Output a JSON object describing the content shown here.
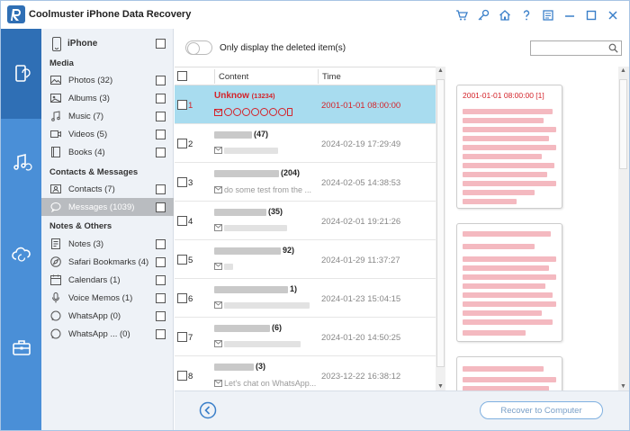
{
  "app": {
    "title": "Coolmuster iPhone Data Recovery"
  },
  "titlebar_icons": [
    "cart-icon",
    "key-icon",
    "home-icon",
    "help-icon",
    "feedback-icon",
    "minimize-icon",
    "maximize-icon",
    "close-icon"
  ],
  "rail": [
    "device-recovery-icon",
    "itunes-recovery-icon",
    "icloud-recovery-icon",
    "toolkit-icon"
  ],
  "sidebar": {
    "device": "iPhone",
    "sections": [
      {
        "title": "Media",
        "items": [
          {
            "label": "Photos  (32)",
            "icon": "photo-icon"
          },
          {
            "label": "Albums  (3)",
            "icon": "album-icon"
          },
          {
            "label": "Music  (7)",
            "icon": "music-icon"
          },
          {
            "label": "Videos  (5)",
            "icon": "video-icon"
          },
          {
            "label": "Books  (4)",
            "icon": "book-icon"
          }
        ]
      },
      {
        "title": "Contacts & Messages",
        "items": [
          {
            "label": "Contacts  (7)",
            "icon": "contact-icon"
          },
          {
            "label": "Messages  (1039)",
            "icon": "message-icon"
          }
        ]
      },
      {
        "title": "Notes & Others",
        "items": [
          {
            "label": "Notes  (3)",
            "icon": "note-icon"
          },
          {
            "label": "Safari Bookmarks  (4)",
            "icon": "safari-icon"
          },
          {
            "label": "Calendars  (1)",
            "icon": "calendar-icon"
          },
          {
            "label": "Voice Memos  (1)",
            "icon": "mic-icon"
          },
          {
            "label": "WhatsApp  (0)",
            "icon": "whatsapp-icon"
          },
          {
            "label": "WhatsApp ...  (0)",
            "icon": "whatsapp-icon"
          }
        ]
      }
    ]
  },
  "toolbar": {
    "toggle_label": "Only display the deleted item(s)",
    "search_placeholder": ""
  },
  "table": {
    "headers": {
      "content": "Content",
      "time": "Time"
    },
    "rows": [
      {
        "num": "1",
        "name": "Unknow",
        "count": "(13234)",
        "preview": "",
        "time": "2001-01-01 08:00:00"
      },
      {
        "num": "2",
        "name": "",
        "count": "(47)",
        "preview": "",
        "time": "2024-02-19 17:29:49"
      },
      {
        "num": "3",
        "name": "",
        "count": "(204)",
        "preview": "do some test from the ...",
        "time": "2024-02-05 14:38:53"
      },
      {
        "num": "4",
        "name": "",
        "count": "(35)",
        "preview": "",
        "time": "2024-02-01 19:21:26"
      },
      {
        "num": "5",
        "name": "",
        "count": "92)",
        "preview": "",
        "time": "2024-01-29 11:37:27"
      },
      {
        "num": "6",
        "name": "",
        "count": "1)",
        "preview": "",
        "time": "2024-01-23 15:04:15"
      },
      {
        "num": "7",
        "name": "",
        "count": "(6)",
        "preview": "",
        "time": "2024-01-20 14:50:25"
      },
      {
        "num": "8",
        "name": "",
        "count": "(3)",
        "preview": "Let's chat on WhatsApp...",
        "time": "2023-12-22 16:38:12"
      }
    ]
  },
  "detail": {
    "first_message_header": "2001-01-01 08:00:00  [1]"
  },
  "footer": {
    "recover_label": "Recover to Computer"
  },
  "colors": {
    "accent": "#4a8fd7",
    "selected_row": "#a8dcef",
    "deleted_text": "#d4232a"
  }
}
